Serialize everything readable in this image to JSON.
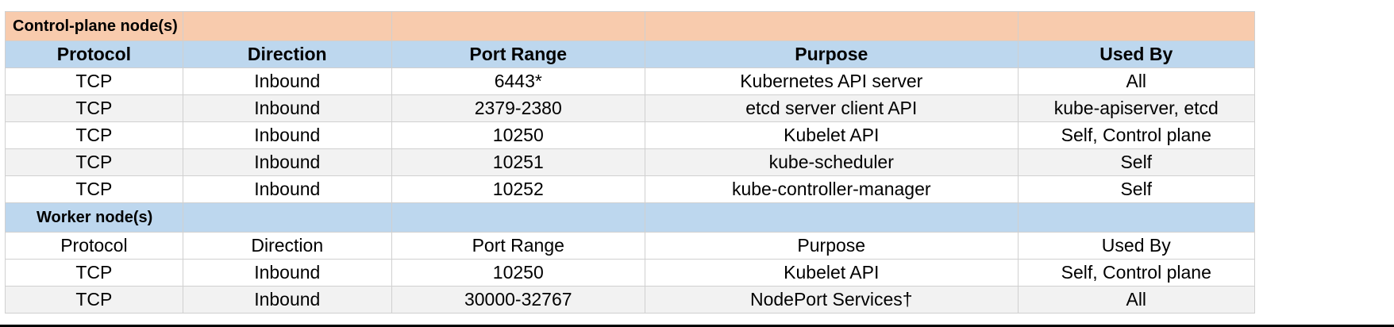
{
  "sections": [
    {
      "title": "Control-plane node(s)",
      "headers": [
        "Protocol",
        "Direction",
        "Port Range",
        "Purpose",
        "Used By"
      ],
      "rows": [
        [
          "TCP",
          "Inbound",
          "6443*",
          "Kubernetes API server",
          "All"
        ],
        [
          "TCP",
          "Inbound",
          "2379-2380",
          "etcd server client API",
          "kube-apiserver, etcd"
        ],
        [
          "TCP",
          "Inbound",
          "10250",
          "Kubelet API",
          "Self, Control plane"
        ],
        [
          "TCP",
          "Inbound",
          "10251",
          "kube-scheduler",
          "Self"
        ],
        [
          "TCP",
          "Inbound",
          "10252",
          "kube-controller-manager",
          "Self"
        ]
      ]
    },
    {
      "title": "Worker node(s)",
      "headers": [
        "Protocol",
        "Direction",
        "Port Range",
        "Purpose",
        "Used By"
      ],
      "rows": [
        [
          "TCP",
          "Inbound",
          "10250",
          "Kubelet API",
          "Self, Control plane"
        ],
        [
          "TCP",
          "Inbound",
          "30000-32767",
          "NodePort Services†",
          "All"
        ]
      ]
    }
  ],
  "colors": {
    "control_plane_section": "#f8cbad",
    "header_fill": "#bdd7ee",
    "alt_row": "#f2f2f2",
    "grid": "#d0d0d0"
  }
}
